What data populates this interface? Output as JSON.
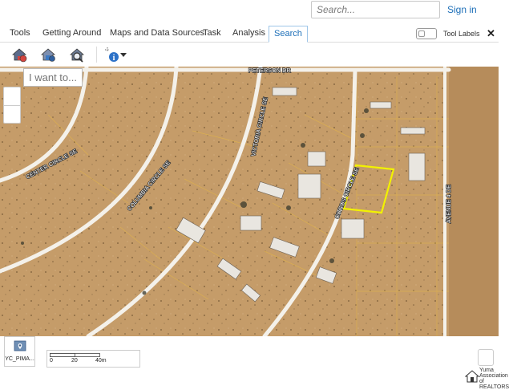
{
  "header": {
    "search_placeholder": "Search...",
    "sign_in": "Sign in"
  },
  "tabs": [
    {
      "label": "Tools"
    },
    {
      "label": "Getting Around"
    },
    {
      "label": "Maps and Data Sources"
    },
    {
      "label": "Task"
    },
    {
      "label": "Analysis"
    },
    {
      "label": "Search",
      "active": true
    }
  ],
  "tool_labels": "Tool Labels",
  "close": "✕",
  "ribbon_icons": [
    "home-search-icon",
    "house-pin-icon",
    "house-magnify-icon",
    "identify-info-icon",
    "dropdown-caret-icon"
  ],
  "map": {
    "i_want_to_placeholder": "I want to...",
    "streets": {
      "peterson": "PETERSON DR",
      "center_circle": "CENTER CIRCLE SE",
      "columbia_circle": "COLUMBIA CIRCLE SE",
      "victoria_circle": "VICTORIA CIRCLE SE",
      "citrus_circle": "CITRUS CIRCLE SE",
      "avenue": "AVENUE 4 DE"
    },
    "highlight_color": "#f2f200"
  },
  "basemap_label": "YC_PIMA...",
  "scale": {
    "labels": [
      "0",
      "20",
      "40m"
    ]
  },
  "logo": {
    "lines": [
      "Yuma",
      "Association",
      "of REALTORS"
    ]
  }
}
